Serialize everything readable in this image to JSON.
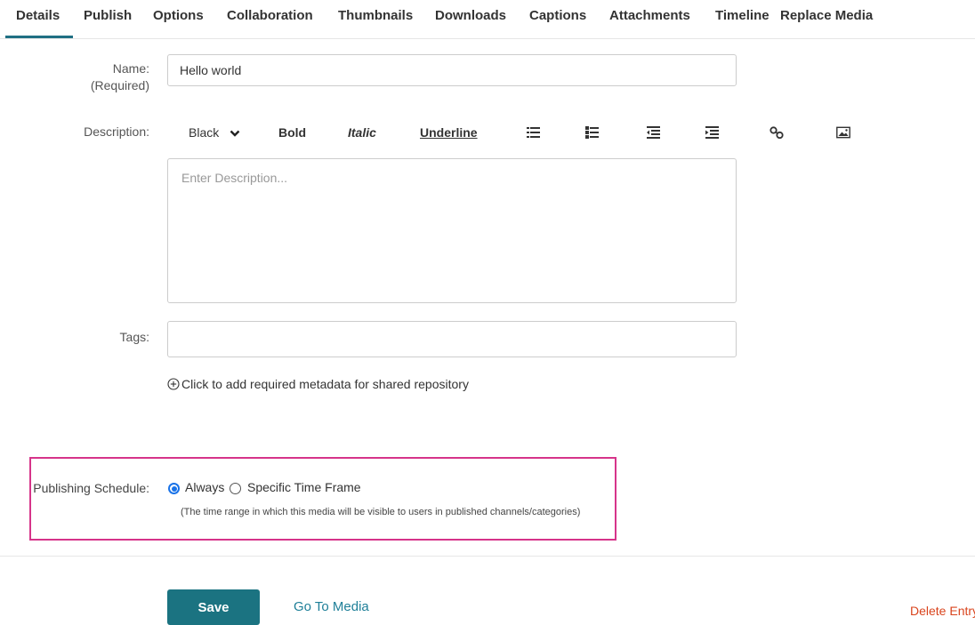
{
  "tabs": [
    {
      "label": "Details"
    },
    {
      "label": "Publish"
    },
    {
      "label": "Options"
    },
    {
      "label": "Collaboration"
    },
    {
      "label": "Thumbnails"
    },
    {
      "label": "Downloads"
    },
    {
      "label": "Captions"
    },
    {
      "label": "Attachments"
    },
    {
      "label": "Timeline"
    },
    {
      "label": "Replace Media"
    }
  ],
  "form": {
    "name_label": "Name:",
    "name_required": "(Required)",
    "name_value": "Hello world",
    "description_label": "Description:",
    "description_placeholder": "Enter Description...",
    "tags_label": "Tags:",
    "add_metadata": "Click to add required metadata for shared repository"
  },
  "toolbar": {
    "color_select": "Black",
    "bold": "Bold",
    "italic": "Italic",
    "underline": "Underline"
  },
  "publishing": {
    "label": "Publishing Schedule:",
    "option_always": "Always",
    "option_specific": "Specific Time Frame",
    "selected": "Always",
    "hint": "(The time range in which this media will be visible to users in published channels/categories)"
  },
  "actions": {
    "save": "Save",
    "go_to_media": "Go To Media",
    "delete_entry": "Delete Entry"
  },
  "colors": {
    "accent": "#1b7381",
    "highlight": "#d6348a",
    "delete": "#d9441d",
    "link": "#1e7f98"
  }
}
